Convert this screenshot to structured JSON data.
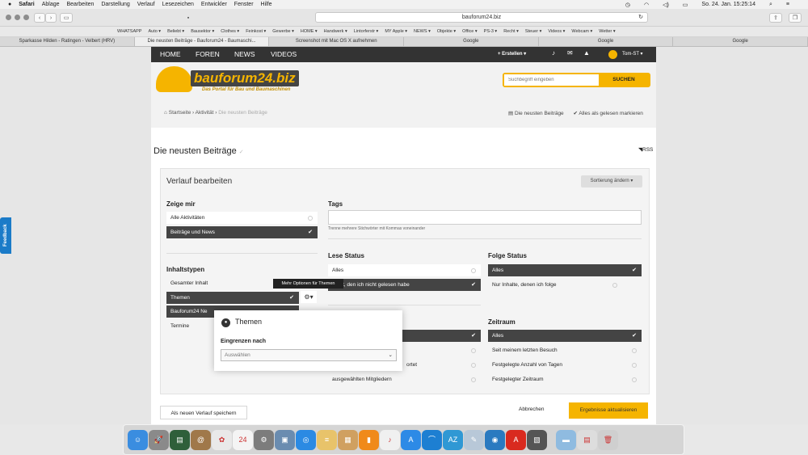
{
  "menubar": {
    "items": [
      "Safari",
      "Ablage",
      "Bearbeiten",
      "Darstellung",
      "Verlauf",
      "Lesezeichen",
      "Entwickler",
      "Fenster",
      "Hilfe"
    ],
    "clock": "So. 24. Jan.  15:25:14"
  },
  "address_bar": {
    "url": "bauforum24.biz"
  },
  "bookmarks": [
    "WHATSAPP",
    "Auto ▾",
    "Beliebt ▾",
    "Bausektor ▾",
    "Clothes ▾",
    "Feinkost ▾",
    "Gewerbe ▾",
    "HOME ▾",
    "Handwerk ▾",
    "Lintorferstr ▾",
    "MY Apple ▾",
    "NEWS ▾",
    "Objekte ▾",
    "Office ▾",
    "PS-3 ▾",
    "Recht ▾",
    "Steuer ▾",
    "Videos ▾",
    "Webcam ▾",
    "Wetter ▾"
  ],
  "tabs": [
    {
      "label": "Sparkasse Hilden - Ratingen - Velbert (HRV)",
      "active": false
    },
    {
      "label": "Die neusten Beiträge - Bauforum24 - Baumaschi...",
      "active": true
    },
    {
      "label": "Screenshot mit Mac OS X aufnehmen",
      "active": false
    },
    {
      "label": "Google",
      "active": false
    },
    {
      "label": "Google",
      "active": false
    },
    {
      "label": "Google",
      "active": false
    }
  ],
  "nav": {
    "items": [
      "HOME",
      "FOREN",
      "NEWS",
      "VIDEOS"
    ],
    "create": "+ Erstellen ▾",
    "user": "Tom-ST ▾"
  },
  "logo": {
    "text": "bauforum24.biz",
    "subtitle": "Das Portal für Bau und Baumaschinen"
  },
  "search": {
    "placeholder": "Suchbegriff eingeben",
    "button": "SUCHEN"
  },
  "breadcrumb": {
    "home": "Startseite",
    "activity": "Aktivität",
    "current": "Die neusten Beiträge"
  },
  "breadcrumb_right": {
    "newest": "Die neusten Beiträge",
    "mark_read": "Alles als gelesen markieren"
  },
  "page": {
    "title": "Die neusten Beiträge",
    "rss": "RSS"
  },
  "filter": {
    "title": "Verlauf bearbeiten",
    "sort_button": "Sortierung ändern ▾",
    "show_me": {
      "heading": "Zeige mir",
      "options": [
        {
          "label": "Alle Aktivitäten"
        },
        {
          "label": "Beiträge und News"
        }
      ]
    },
    "tags": {
      "heading": "Tags",
      "hint": "Trenne mehrere Stichwörter mit Kommas voneinander"
    },
    "content_types": {
      "heading": "Inhaltstypen",
      "options": [
        {
          "label": "Gesamter Inhalt"
        },
        {
          "label": "Themen"
        },
        {
          "label": "Bauforum24 Ne"
        },
        {
          "label": "Termine"
        }
      ]
    },
    "read_status": {
      "heading": "Lese Status",
      "options": [
        {
          "label": "Alles"
        },
        {
          "label": "t, den ich nicht gelesen habe"
        }
      ]
    },
    "follow_status": {
      "heading": "Folge Status",
      "options": [
        {
          "label": "Alles"
        },
        {
          "label": "Nur Inhalte, denen ich folge"
        }
      ]
    },
    "author": {
      "options": [
        {
          "label": "ortet"
        },
        {
          "label": "ausgewählten Mitgliedern"
        }
      ]
    },
    "time_range": {
      "heading": "Zeitraum",
      "options": [
        {
          "label": "Alles"
        },
        {
          "label": "Seit meinem letzten Besuch"
        },
        {
          "label": "Festgelegte Anzahl von Tagen"
        },
        {
          "label": "Festgelegter Zeitraum"
        }
      ]
    },
    "tooltip": "Mehr Optionen für Themen",
    "popup": {
      "title": "Themen",
      "label": "Eingrenzen nach",
      "select_value": "Auswählen"
    },
    "save_button": "Als neuen Verlauf speichern",
    "cancel": "Abbrechen",
    "apply_button": "Ergebnisse aktualisieren"
  },
  "feedback": "Feedback",
  "colors": {
    "accent": "#f5b400",
    "nav": "#333333",
    "selected": "#444444",
    "feedback": "#1b7bc8"
  },
  "dock": [
    {
      "icon": "finder-icon",
      "glyph": "☺",
      "color": "#3a8de0"
    },
    {
      "icon": "launchpad-icon",
      "glyph": "🚀",
      "color": "#8a8a8a"
    },
    {
      "icon": "app-icon",
      "glyph": "▤",
      "color": "#2f5f3a"
    },
    {
      "icon": "contacts-icon",
      "glyph": "@",
      "color": "#a0784a"
    },
    {
      "icon": "photos-icon",
      "glyph": "✿",
      "color": "#e9e9e9"
    },
    {
      "icon": "calendar-icon",
      "glyph": "24",
      "color": "#f4f4f4"
    },
    {
      "icon": "system-preferences-icon",
      "glyph": "⚙",
      "color": "#7c7c7c"
    },
    {
      "icon": "preview-icon",
      "glyph": "▣",
      "color": "#6a8cb0"
    },
    {
      "icon": "safari-icon",
      "glyph": "◎",
      "color": "#2b8ae3"
    },
    {
      "icon": "notes-icon",
      "glyph": "≡",
      "color": "#e8c36a"
    },
    {
      "icon": "app-icon",
      "glyph": "▦",
      "color": "#d0a060"
    },
    {
      "icon": "books-icon",
      "glyph": "▮",
      "color": "#f08a1a"
    },
    {
      "icon": "music-icon",
      "glyph": "♪",
      "color": "#f0f0f0"
    },
    {
      "icon": "app-store-icon",
      "glyph": "A",
      "color": "#2d8ae6"
    },
    {
      "icon": "app-icon",
      "glyph": "⌒",
      "color": "#1d7fd2"
    },
    {
      "icon": "azure-icon",
      "glyph": "AZ",
      "color": "#2f98d4"
    },
    {
      "icon": "app-icon",
      "glyph": "✎",
      "color": "#b8c8d8"
    },
    {
      "icon": "globe-icon",
      "glyph": "◉",
      "color": "#2a7ac0"
    },
    {
      "icon": "pdf-icon",
      "glyph": "A",
      "color": "#d92a1f"
    },
    {
      "icon": "app-icon",
      "glyph": "▧",
      "color": "#555555"
    },
    {
      "icon": "folder-icon",
      "glyph": "▬",
      "color": "#8fbbe0"
    },
    {
      "icon": "documents-icon",
      "glyph": "▤",
      "color": "#dddddd"
    },
    {
      "icon": "trash-icon",
      "glyph": "🗑",
      "color": "#cfcfcf"
    }
  ]
}
